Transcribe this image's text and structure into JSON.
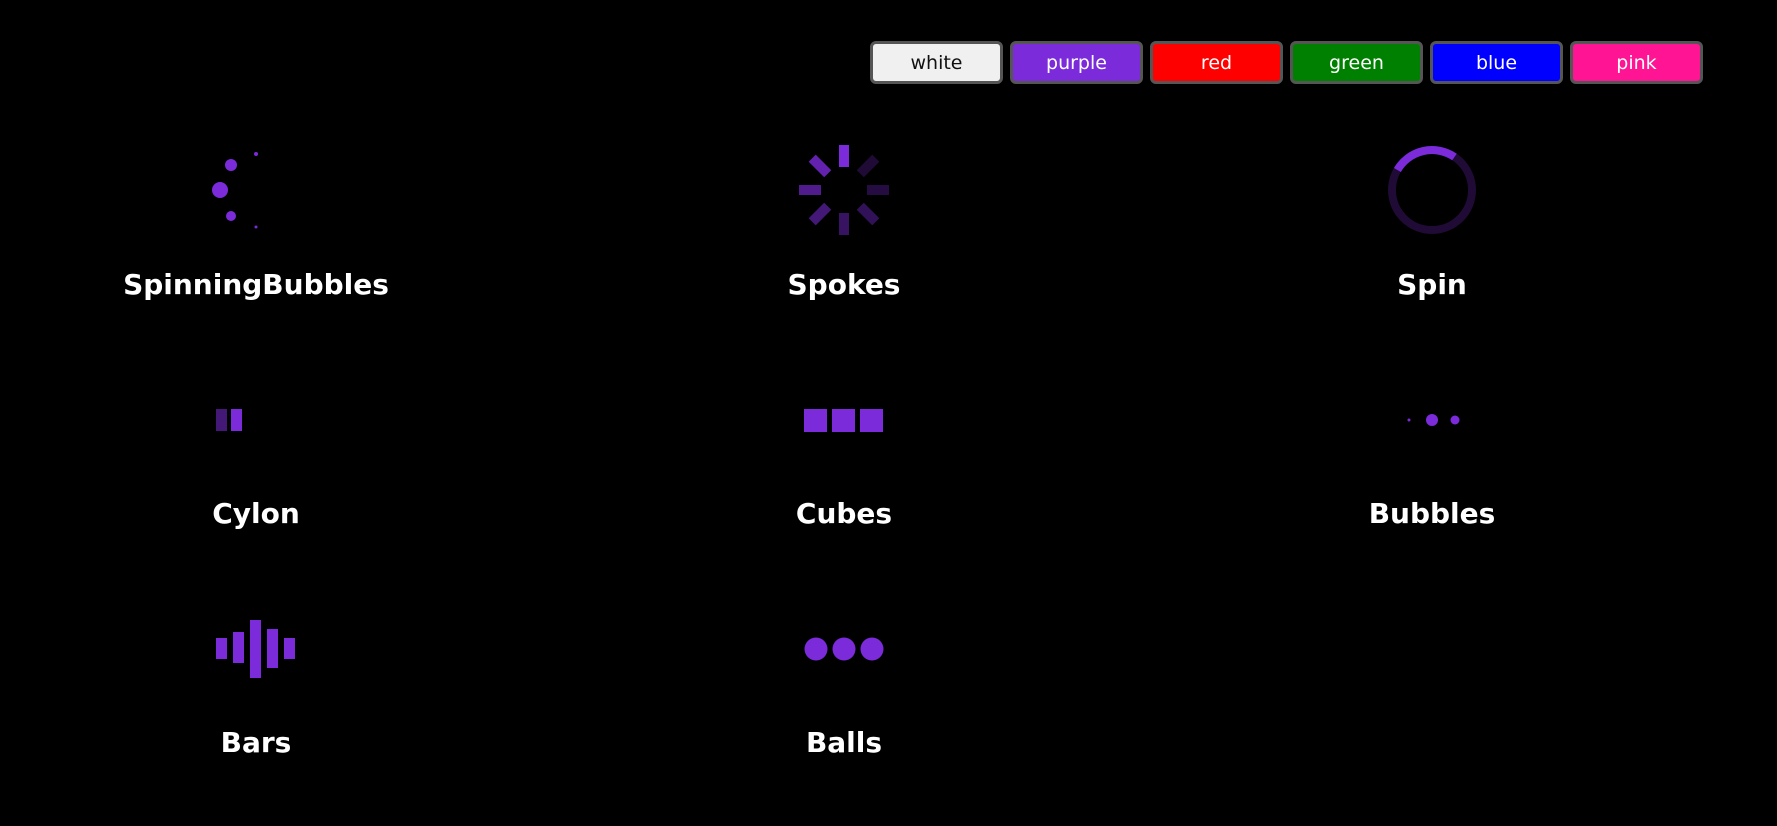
{
  "colors": {
    "accent": "#7b2bd9",
    "background": "#000000",
    "label": "#ffffff"
  },
  "color_buttons": [
    {
      "label": "white",
      "color": "#f0f0f0"
    },
    {
      "label": "purple",
      "color": "#7b2bd9"
    },
    {
      "label": "red",
      "color": "#ff0000"
    },
    {
      "label": "green",
      "color": "#008000"
    },
    {
      "label": "blue",
      "color": "#0000ff"
    },
    {
      "label": "pink",
      "color": "#ff1493"
    }
  ],
  "loaders": [
    {
      "label": "SpinningBubbles",
      "icon": "spinning-bubbles-icon"
    },
    {
      "label": "Spokes",
      "icon": "spokes-icon"
    },
    {
      "label": "Spin",
      "icon": "spin-icon"
    },
    {
      "label": "Cylon",
      "icon": "cylon-icon"
    },
    {
      "label": "Cubes",
      "icon": "cubes-icon"
    },
    {
      "label": "Bubbles",
      "icon": "bubbles-icon"
    },
    {
      "label": "Bars",
      "icon": "bars-icon"
    },
    {
      "label": "Balls",
      "icon": "balls-icon"
    }
  ]
}
